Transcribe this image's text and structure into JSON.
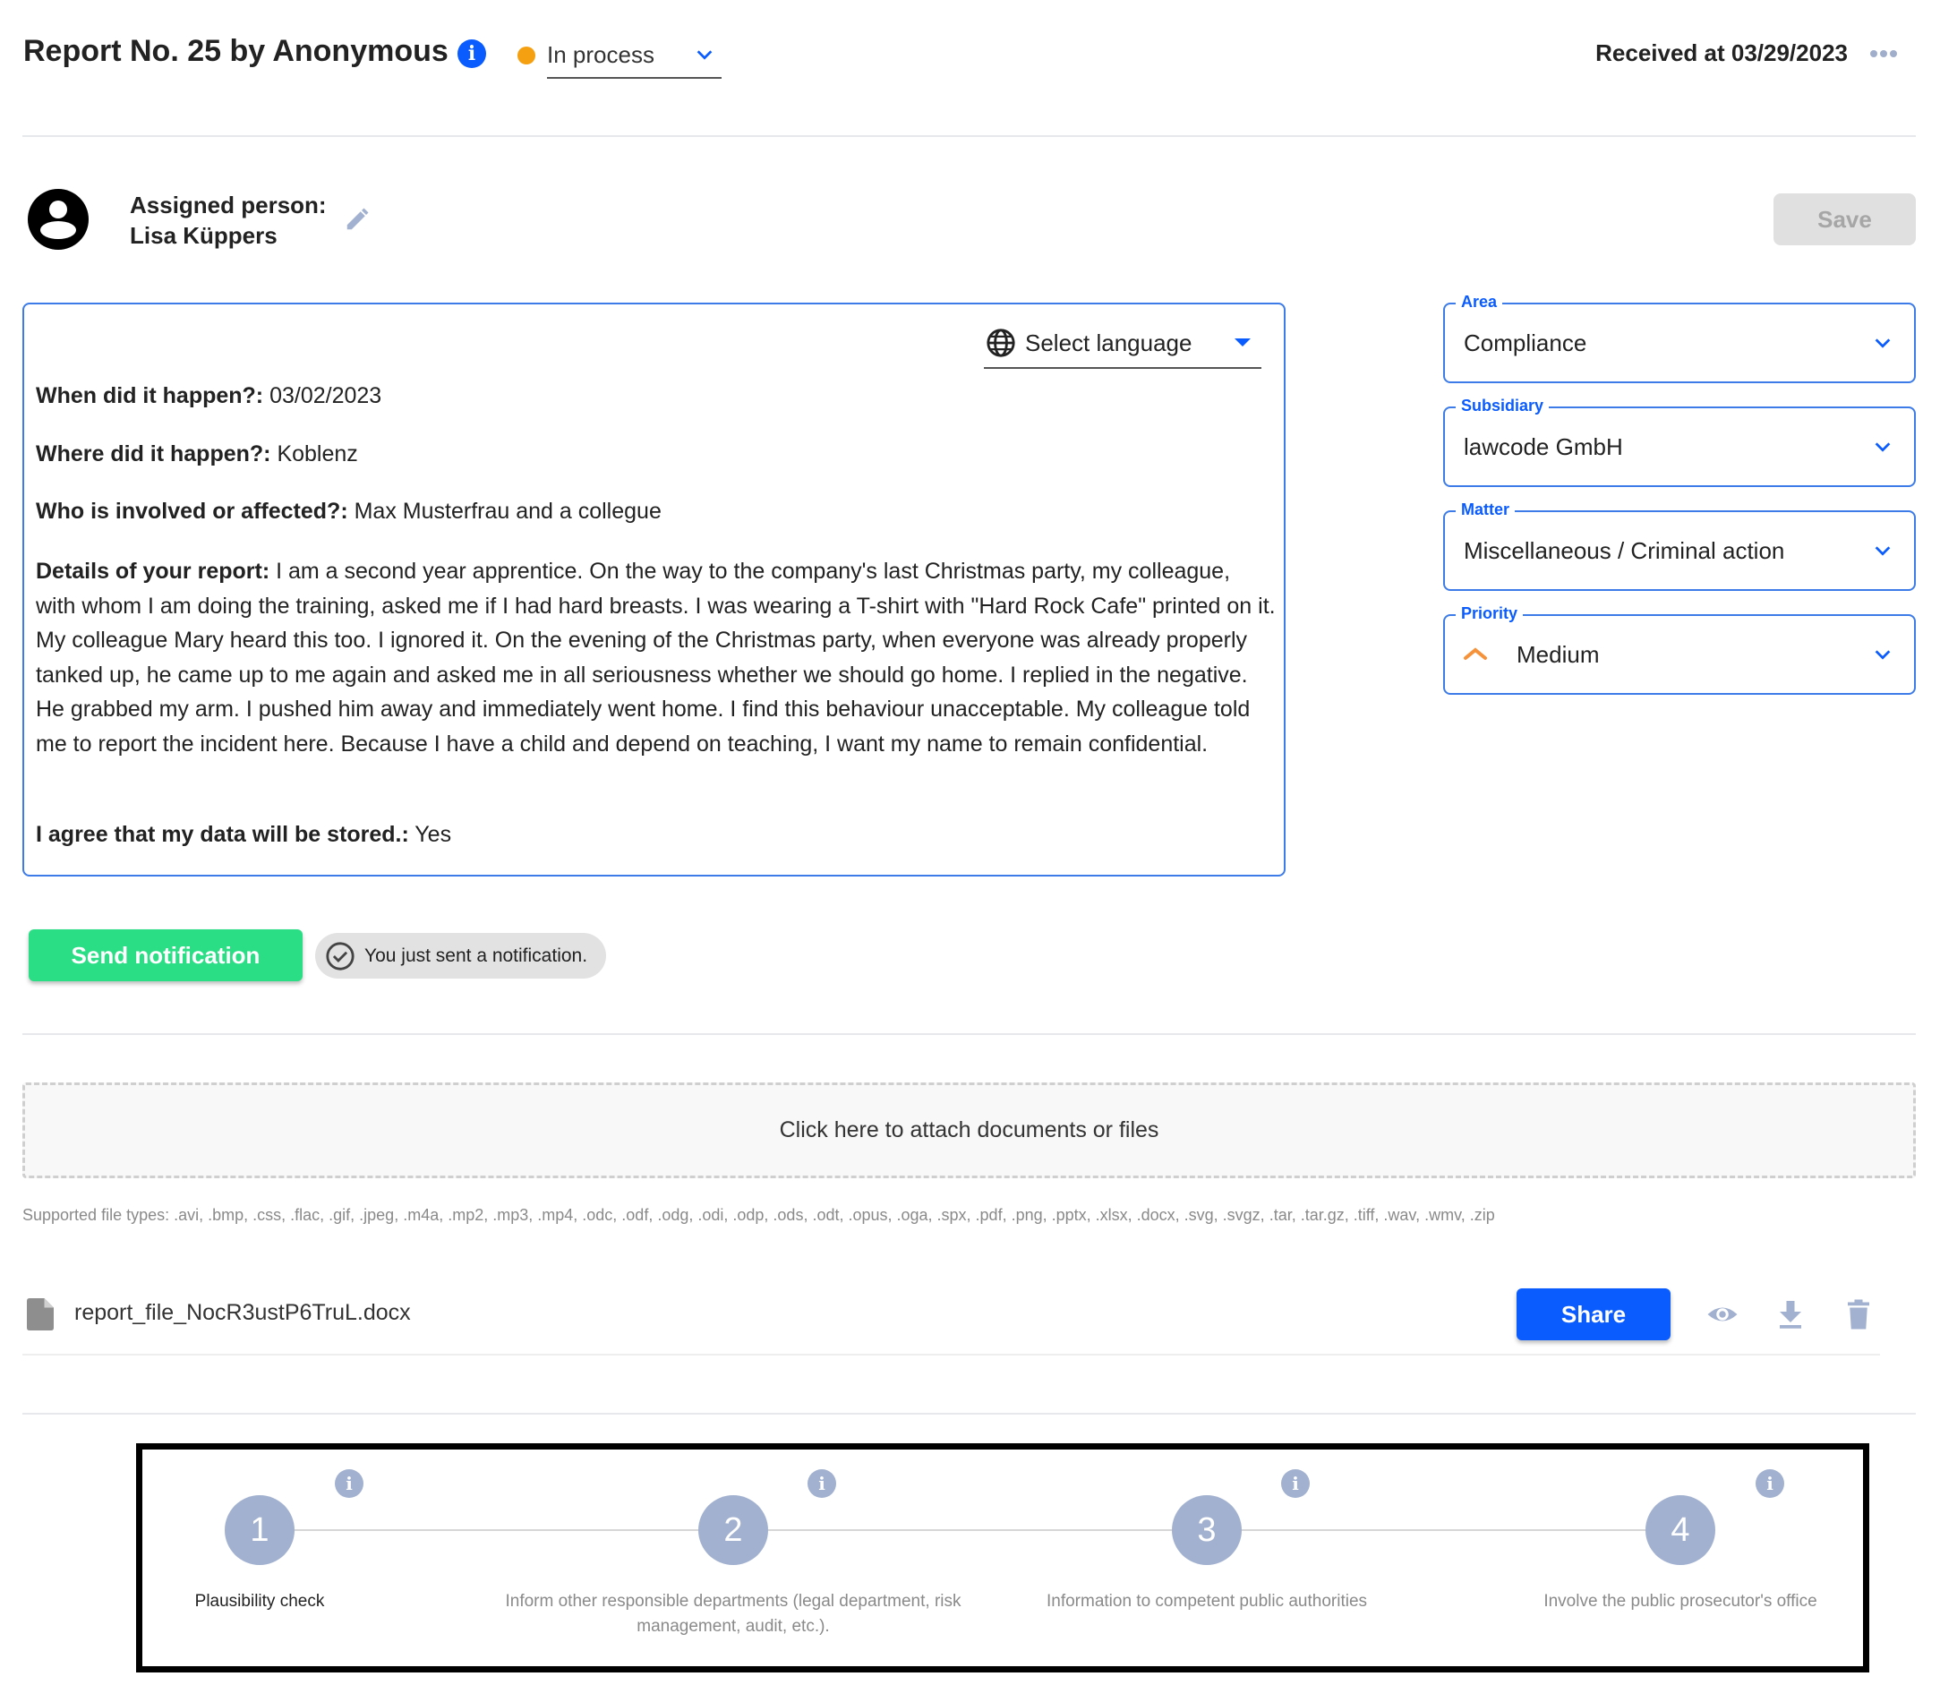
{
  "header": {
    "title": "Report No. 25 by Anonymous",
    "info_icon": "info-icon",
    "status": {
      "label": "In process",
      "dot_color": "#f5a010"
    },
    "received": "Received at 03/29/2023",
    "more_icon": "more-horizontal-icon"
  },
  "assigned": {
    "label": "Assigned person:",
    "name": "Lisa Küppers",
    "avatar_icon": "account-circle-icon",
    "edit_icon": "pencil-icon"
  },
  "toolbar": {
    "save_label": "Save"
  },
  "report": {
    "language_select": {
      "label": "Select language",
      "icon": "globe-icon"
    },
    "fields": [
      {
        "label": "When did it happen?:",
        "value": "03/02/2023"
      },
      {
        "label": "Where did it happen?:",
        "value": "Koblenz"
      },
      {
        "label": "Who is involved or affected?:",
        "value": "Max Musterfrau and a collegue"
      },
      {
        "label": "Details of your report:",
        "value": "I am a second year apprentice. On the way to the company's last Christmas party, my colleague, with whom I am doing the training, asked me if I had hard breasts. I was wearing a T-shirt with \"Hard Rock Cafe\" printed on it. My colleague Mary heard this too. I ignored it. On the evening of the Christmas party, when everyone was already properly tanked up, he came up to me again and asked me in all seriousness whether we should go home. I replied in the negative. He grabbed my arm. I pushed him away and immediately went home. I find this behaviour unacceptable. My colleague told me to report the incident here. Because I have a child and depend on teaching, I want my name to remain confidential."
      },
      {
        "label": "I agree that my data will be stored.:",
        "value": "Yes"
      }
    ]
  },
  "classification": {
    "area": {
      "legend": "Area",
      "value": "Compliance"
    },
    "subsidiary": {
      "legend": "Subsidiary",
      "value": "lawcode GmbH"
    },
    "matter": {
      "legend": "Matter",
      "value": "Miscellaneous / Criminal action"
    },
    "priority": {
      "legend": "Priority",
      "value": "Medium",
      "icon": "chevron-up-priority-icon",
      "icon_color": "#f5923a"
    }
  },
  "notification": {
    "send_label": "Send notification",
    "sent_message": "You just sent a notification."
  },
  "attachments": {
    "dropzone_label": "Click here to attach documents or files",
    "supported_types": "Supported file types: .avi, .bmp, .css, .flac, .gif, .jpeg, .m4a, .mp2, .mp3, .mp4, .odc, .odf, .odg, .odi, .odp, .ods, .odt, .opus, .oga, .spx, .pdf, .png, .pptx, .xlsx, .docx, .svg, .svgz, .tar, .tar.gz, .tiff, .wav, .wmv, .zip",
    "files": [
      {
        "name": "report_file_NocR3ustP6TruL.docx",
        "share_label": "Share"
      }
    ]
  },
  "steps": [
    {
      "number": "1",
      "label": "Plausibility check"
    },
    {
      "number": "2",
      "label": "Inform other responsible departments (legal department, risk management, audit, etc.)."
    },
    {
      "number": "3",
      "label": "Information to competent public authorities"
    },
    {
      "number": "4",
      "label": "Involve the public prosecutor's office"
    }
  ],
  "colors": {
    "accent": "#0a5cff",
    "success": "#2ade85",
    "step": "#a2b1cf",
    "border": "#3c7be8"
  }
}
